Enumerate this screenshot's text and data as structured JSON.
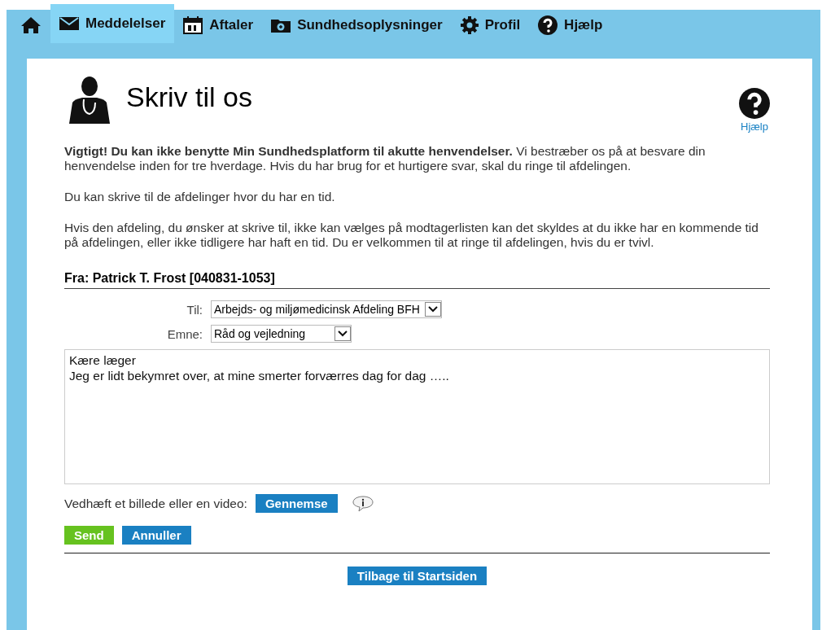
{
  "nav": {
    "tabs": [
      {
        "kind": "home",
        "selected": false
      },
      {
        "kind": "mail",
        "label": "Meddelelser",
        "selected": true
      },
      {
        "kind": "calendar",
        "label": "Aftaler",
        "selected": false
      },
      {
        "kind": "folder",
        "label": "Sundhedsoplysninger",
        "selected": false
      },
      {
        "kind": "gear",
        "label": "Profil",
        "selected": false
      },
      {
        "kind": "help",
        "label": "Hjælp",
        "selected": false
      }
    ]
  },
  "page": {
    "title": "Skriv til os",
    "help_link": "Hjælp",
    "paragraphs": [
      "**Vigtigt! Du kan ikke benytte Min Sundhedsplatform til akutte henvendelser.** Vi bestræber os på at besvare din henvendelse inden for tre hverdage. Hvis du har brug for et hurtigere svar, skal du ringe til afdelingen.",
      "Du kan skrive til de afdelinger hvor du har en tid.",
      "Hvis den afdeling, du ønsker at skrive til, ikke kan vælges på modtagerlisten kan det skyldes at du ikke har en kommende tid på afdelingen, eller ikke tidligere har haft en tid. Du er velkommen til at ringe til afdelingen, hvis du er tvivl."
    ]
  },
  "form": {
    "from": "Fra: Patrick T. Frost [040831-1053]",
    "fields": [
      {
        "label": "Til:",
        "value": "Arbejds- og miljømedicinsk Afdeling BFH"
      },
      {
        "label": "Emne:",
        "value": "Råd og vejledning"
      }
    ],
    "message": "Kære læger\nJeg er lidt bekymret over, at mine smerter forværres dag for dag …..",
    "attach_label": "Vedhæft et billede eller en video:",
    "browse_button": "Gennemse",
    "send_button": "Send",
    "cancel_button": "Annuller",
    "back_button": "Tilbage til Startsiden"
  }
}
